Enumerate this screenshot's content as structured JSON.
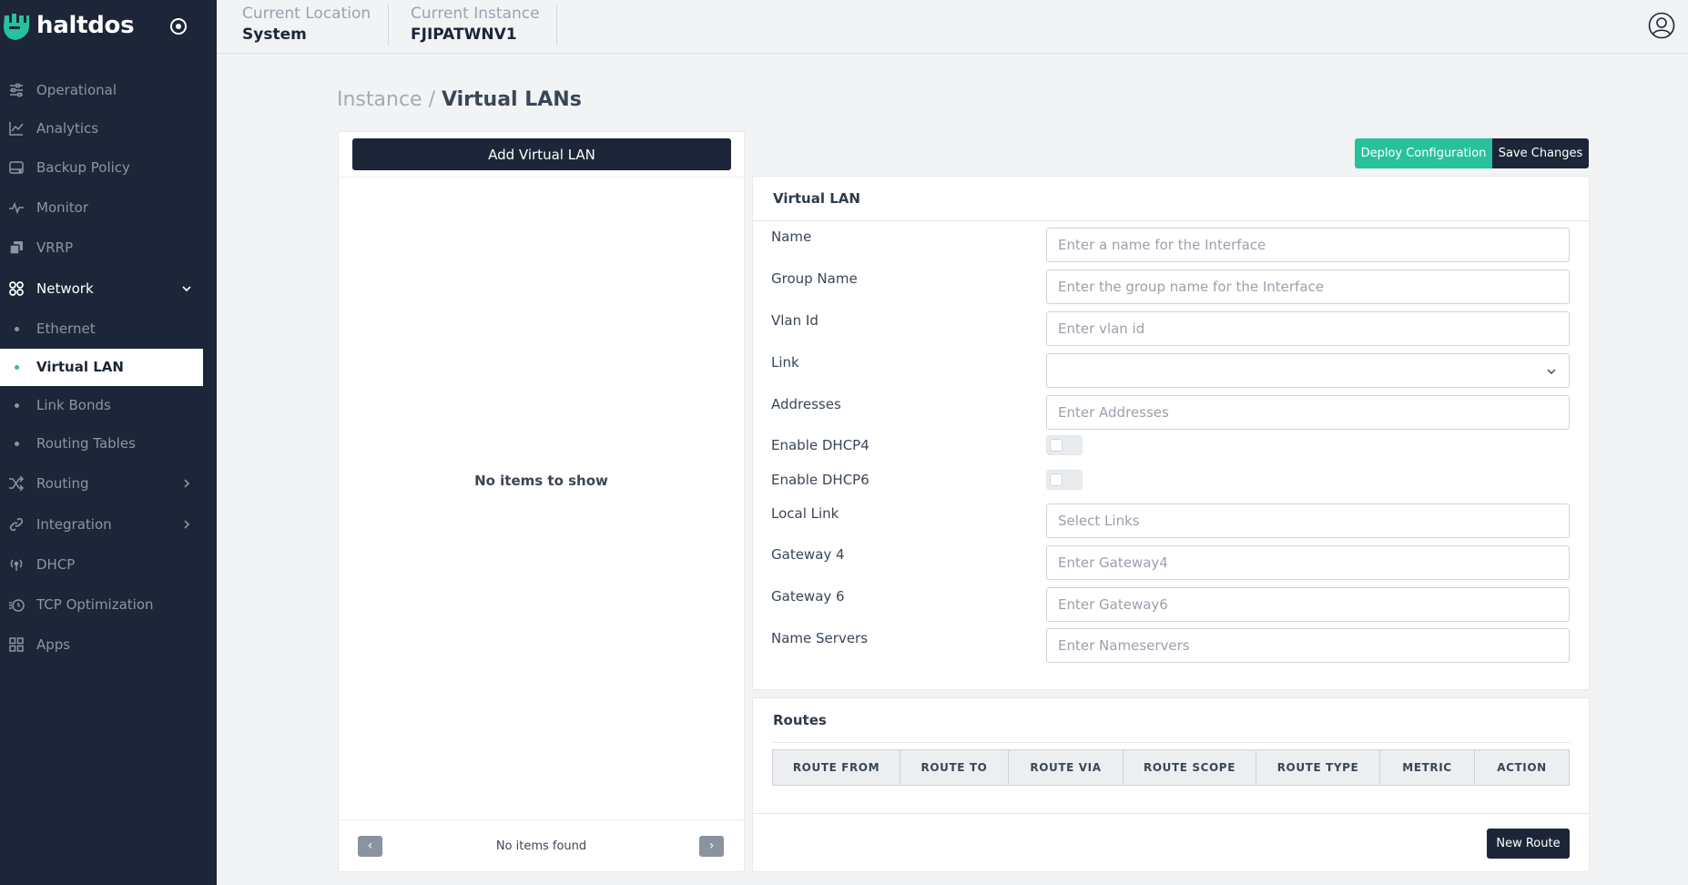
{
  "brand": {
    "name": "haltdos"
  },
  "sidebar": {
    "items": [
      {
        "label": "Operational",
        "icon": "sliders-icon"
      },
      {
        "label": "Analytics",
        "icon": "line-chart-icon"
      },
      {
        "label": "Backup Policy",
        "icon": "hard-drive-icon"
      },
      {
        "label": "Monitor",
        "icon": "pulse-icon"
      },
      {
        "label": "VRRP",
        "icon": "copy-stack-icon"
      },
      {
        "label": "Network",
        "icon": "network-nodes-icon",
        "expanded": true
      },
      {
        "label": "Routing",
        "icon": "shuffle-icon"
      },
      {
        "label": "Integration",
        "icon": "link-icon"
      },
      {
        "label": "DHCP",
        "icon": "antenna-icon"
      },
      {
        "label": "TCP Optimization",
        "icon": "timer-icon"
      },
      {
        "label": "Apps",
        "icon": "apps-grid-icon"
      }
    ],
    "network_sub": [
      {
        "label": "Ethernet"
      },
      {
        "label": "Virtual LAN",
        "active": true
      },
      {
        "label": "Link Bonds"
      },
      {
        "label": "Routing Tables"
      }
    ]
  },
  "header": {
    "location_caption": "Current Location",
    "location_value": "System",
    "instance_caption": "Current Instance",
    "instance_value": "FJIPATWNV1"
  },
  "breadcrumb": {
    "parent": "Instance",
    "separator": "/",
    "current": "Virtual LANs"
  },
  "list_panel": {
    "add_label": "Add Virtual LAN",
    "empty_message": "No items to show",
    "pager_info": "No items found",
    "prev_glyph": "‹",
    "next_glyph": "›"
  },
  "actions": {
    "deploy_label": "Deploy Configuration",
    "save_label": "Save Changes"
  },
  "form": {
    "title": "Virtual LAN",
    "name_label": "Name",
    "name_placeholder": "Enter a name for the Interface",
    "group_label": "Group Name",
    "group_placeholder": "Enter the group name for the Interface",
    "vlan_label": "Vlan Id",
    "vlan_placeholder": "Enter vlan id",
    "link_label": "Link",
    "link_value": "",
    "addresses_label": "Addresses",
    "addresses_placeholder": "Enter Addresses",
    "dhcp4_label": "Enable DHCP4",
    "dhcp4_enabled": false,
    "dhcp6_label": "Enable DHCP6",
    "dhcp6_enabled": false,
    "locallink_label": "Local Link",
    "locallink_placeholder": "Select Links",
    "gw4_label": "Gateway 4",
    "gw4_placeholder": "Enter Gateway4",
    "gw6_label": "Gateway 6",
    "gw6_placeholder": "Enter Gateway6",
    "ns_label": "Name Servers",
    "ns_placeholder": "Enter Nameservers"
  },
  "routes": {
    "title": "Routes",
    "columns": [
      "ROUTE FROM",
      "ROUTE TO",
      "ROUTE VIA",
      "ROUTE SCOPE",
      "ROUTE TYPE",
      "METRIC",
      "ACTION"
    ],
    "new_label": "New Route"
  },
  "colors": {
    "sidebar": "#1c2638",
    "accent": "#27c29d",
    "primary_button": "#1c2638"
  }
}
